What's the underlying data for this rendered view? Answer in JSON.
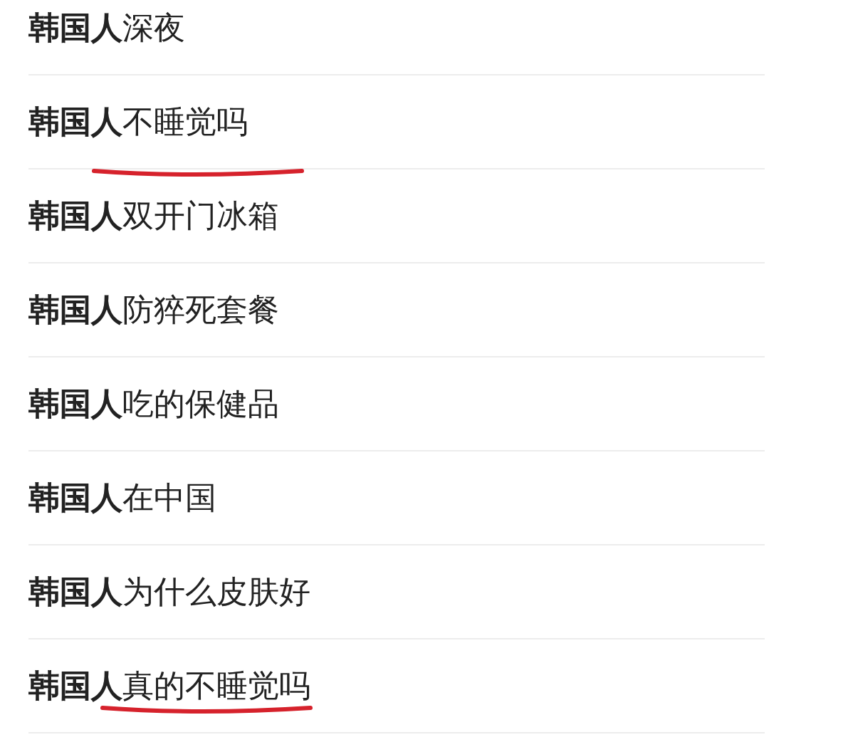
{
  "suggestions": [
    {
      "text": "**韩国人**深夜",
      "underlined": false
    },
    {
      "text": "**韩国人**不睡觉吗",
      "underlined": true
    },
    {
      "text": "**韩国人**双开门冰箱",
      "underlined": false
    },
    {
      "text": "**韩国人**防猝死套餐",
      "underlined": false
    },
    {
      "text": "**韩国人**吃的保健品",
      "underlined": false
    },
    {
      "text": "**韩国人**在中国",
      "underlined": false
    },
    {
      "text": "**韩国人**为什么皮肤好",
      "underlined": false
    },
    {
      "text": "**韩国人**真的不睡觉吗",
      "underlined": true
    }
  ]
}
